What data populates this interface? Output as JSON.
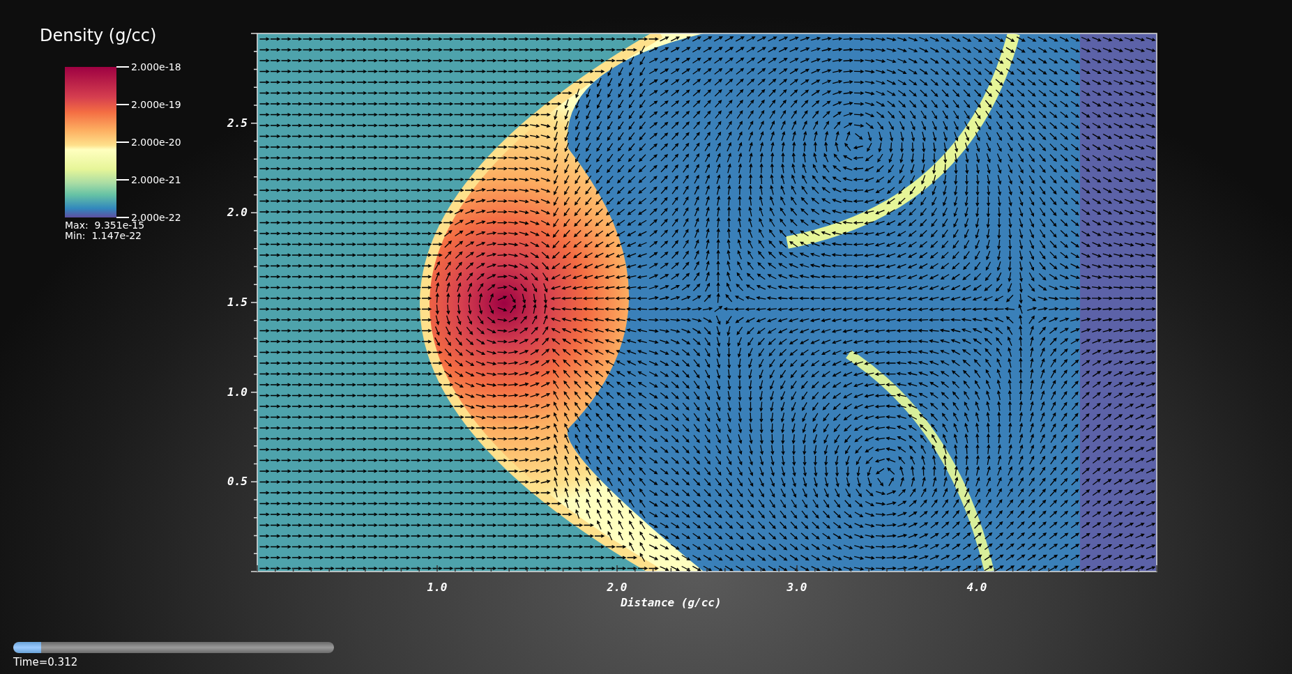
{
  "legend": {
    "title": "Density (g/cc)",
    "tick_labels": [
      "2.000e-18",
      "2.000e-19",
      "2.000e-20",
      "2.000e-21",
      "2.000e-22"
    ],
    "max": "Max:  9.351e-15",
    "min": "Min:  1.147e-22"
  },
  "plot": {
    "x_axis": {
      "title": "Distance (g/cc)",
      "tick_labels": [
        "1.0",
        "2.0",
        "3.0",
        "4.0"
      ]
    },
    "y_axis": {
      "tick_labels": [
        "0.5",
        "1.0",
        "1.5",
        "2.0",
        "2.5"
      ]
    }
  },
  "time_slider": {
    "level": 0.087,
    "label": "Time=0.312"
  }
}
